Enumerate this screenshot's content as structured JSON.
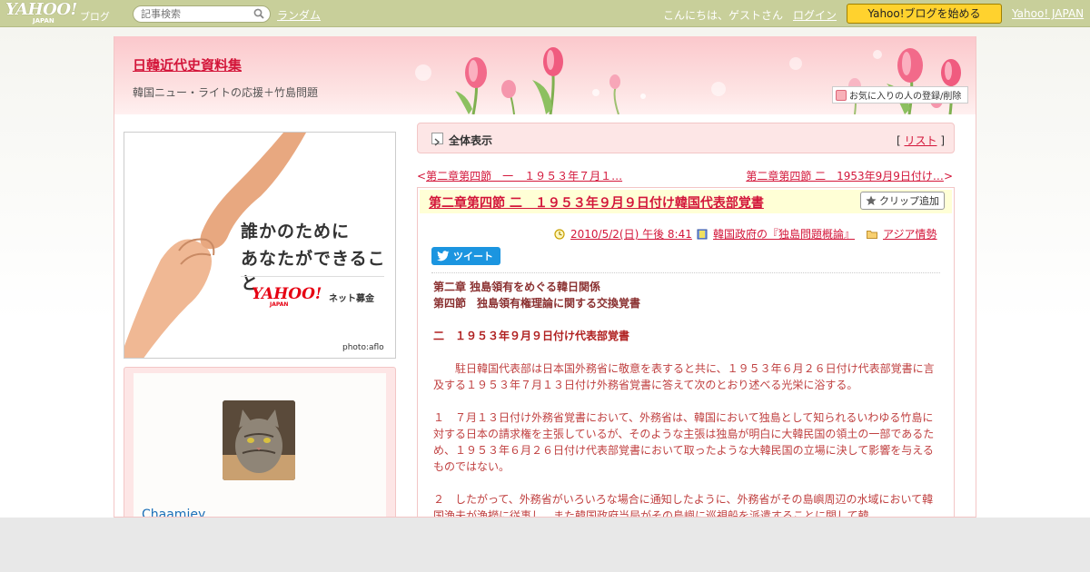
{
  "topbar": {
    "logo_main": "YAHOO!",
    "logo_sub": "ブログ",
    "logo_japan": "JAPAN",
    "search_placeholder": "記事検索",
    "random_link": "ランダム",
    "greeting": "こんにちは、ゲストさん",
    "login_link": "ログイン",
    "start_button": "Yahoo!ブログを始める",
    "yahoo_japan_link": "Yahoo! JAPAN",
    "colors": {
      "bar": "#c8cf9a",
      "start_button": "#ffd22e"
    }
  },
  "header": {
    "title": "日韓近代史資料集",
    "description": "韓国ニュー・ライトの応援＋竹島問題",
    "fav_button": "お気に入りの人の登録/削除"
  },
  "banner": {
    "line1": "誰かのために",
    "line2": "あなたができること",
    "brand": "YAHOO!",
    "brand_sub": "JAPAN",
    "service": "ネット募金",
    "credit": "photo:aflo"
  },
  "profile": {
    "name": "Chaamiey"
  },
  "view_bar": {
    "label": "全体表示",
    "list_open": "[ ",
    "list_link": "リスト",
    "list_close": " ]"
  },
  "nav": {
    "prev_marker": "<",
    "prev": "第二章第四節　一　１９５３年７月１…",
    "next": "第二章第四節 二　1953年9月9日付け…",
    "next_marker": ">"
  },
  "article": {
    "title": "第二章第四節 二　１９５３年９月９日付け韓国代表部覚書",
    "clip_button": "クリップ追加",
    "date": "2010/5/2(日) 午後 8:41",
    "category": "韓国政府の『独島問題概論』",
    "folder": "アジア情勢",
    "tweet": "ツイート",
    "heading1": "第二章 独島領有をめぐる韓日関係",
    "heading2": "第四節　独島領有権理論に関する交換覚書",
    "section": "二　１９５３年９月９日付け代表部覚書",
    "para1": "　　駐日韓国代表部は日本国外務省に敬意を表すると共に、１９５３年６月２６日付け代表部覚書に言及する１９５３年７月１３日付け外務省覚書に答えて次のとおり述べる光栄に浴する。",
    "para2": "１　７月１３日付け外務省覚書において、外務省は、韓国において独島として知られるいわゆる竹島に対する日本の請求権を主張しているが、そのような主張は独島が明白に大韓民国の領土の一部であるため、１９５３年６月２６日付け代表部覚書において取ったような大韓民国の立場に決して影響を与えるものではない。",
    "para3": "２　したがって、外務省がいろいろな場合に通知したように、外務省がその島嶼周辺の水域において韓国漁夫が漁撈に従事し、また韓国政府当局がその島嶼に巡視船を派遣することに関して韓",
    "colors": {
      "link": "#d3163a",
      "body": "#c04040",
      "head_bg": "#ffffd6"
    }
  }
}
